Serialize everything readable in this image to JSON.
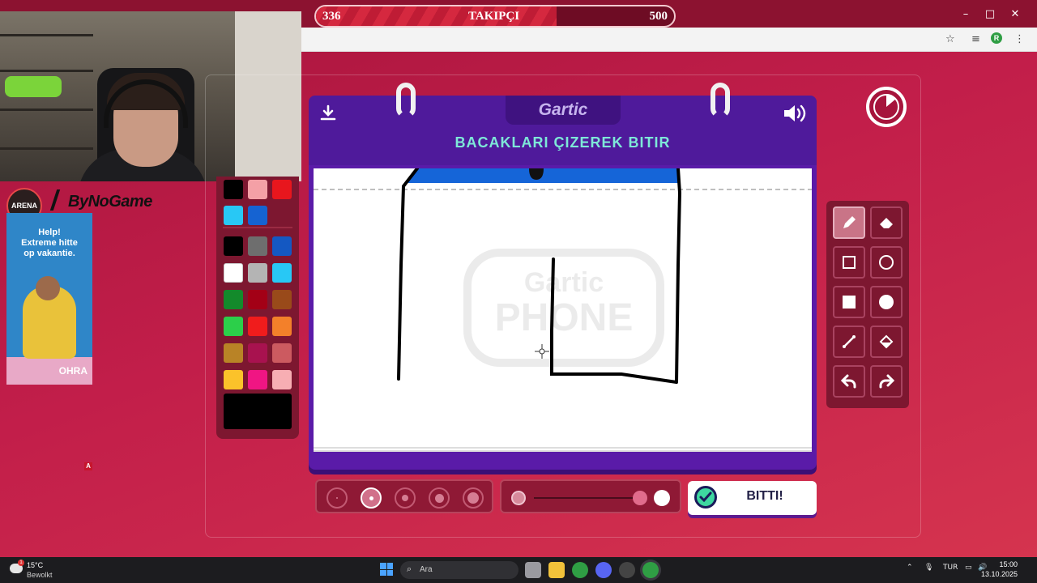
{
  "follower_bar": {
    "current": "336",
    "label": "TAKIPÇI",
    "goal": "500",
    "progress": 0.672
  },
  "branding": {
    "streamer_name": "ByNoGame",
    "logo_text": "ARENA"
  },
  "ad": {
    "text": "Help!\nExtreme hitte\nop vakantie.",
    "brand": "OHRA"
  },
  "overlay_badge": "A",
  "game": {
    "logo": "Gartic",
    "task": "BACAKLARI ÇIZEREK BITIR",
    "watermark_top": "Gartic",
    "watermark_bottom": "PHONE",
    "done_label": "BITTI!"
  },
  "palette": {
    "top_colors": [
      "#000000",
      "#f4a0a6",
      "#e8161d",
      "#28c8f5",
      "#1563d2"
    ],
    "colors": [
      "#000000",
      "#6e6e6e",
      "#1458c2",
      "#ffffff",
      "#b4b4b4",
      "#28c8f5",
      "#138a2b",
      "#a30016",
      "#994a1a",
      "#2ccf4a",
      "#f01c1c",
      "#f3802a",
      "#b98326",
      "#a8124f",
      "#cc5a60",
      "#fbc22a",
      "#f01583",
      "#f7aeb3"
    ],
    "selected": "#000000"
  },
  "tools": [
    {
      "name": "pencil",
      "active": true
    },
    {
      "name": "eraser",
      "active": false
    },
    {
      "name": "rectangle-outline",
      "active": false
    },
    {
      "name": "circle-outline",
      "active": false
    },
    {
      "name": "rectangle-filled",
      "active": false
    },
    {
      "name": "circle-filled",
      "active": false
    },
    {
      "name": "line",
      "active": false
    },
    {
      "name": "fill-bucket",
      "active": false
    },
    {
      "name": "undo",
      "active": false
    },
    {
      "name": "redo",
      "active": false
    }
  ],
  "brush_sizes": {
    "count": 5,
    "selected_index": 1
  },
  "opacity_level": 1.0,
  "taskbar": {
    "weather_temp": "15°C",
    "weather_condition": "Bewolkt",
    "weather_badge": "1",
    "search_placeholder": "Ara",
    "language": "TUR",
    "time": "15:00",
    "date": "13.10.2025"
  },
  "colors": {
    "accent": "#c21e4a",
    "board": "#5a1ba8",
    "task_text": "#7ee8d8"
  }
}
